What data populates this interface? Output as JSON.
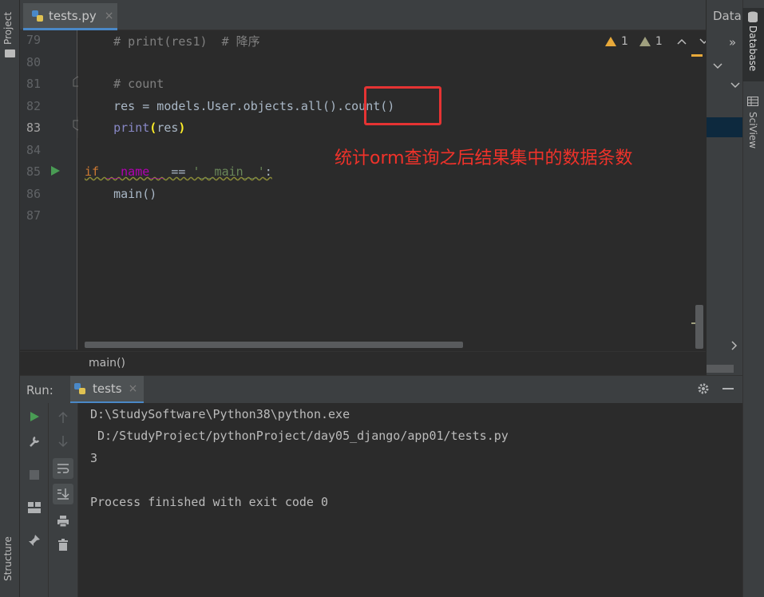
{
  "left_strip": {
    "project_label": "Project",
    "structure_label": "Structure"
  },
  "editor_tab": {
    "filename": "tests.py",
    "close": "×"
  },
  "inspections": {
    "warnings": "1",
    "weak_warnings": "1",
    "up": "^",
    "down": "v"
  },
  "lines": [
    {
      "num": "79",
      "code": "    # print(res1)  # 降序"
    },
    {
      "num": "80",
      "code": ""
    },
    {
      "num": "81",
      "code": "    # count"
    },
    {
      "num": "82",
      "code_plain_a": "    res = models.User.objects.all()",
      "code_plain_b": ".count()"
    },
    {
      "num": "83",
      "code_print": "print",
      "code_args": "res"
    },
    {
      "num": "84",
      "code": ""
    },
    {
      "num": "85",
      "kw_if": "if",
      "name": "__name__",
      "eq": " == ",
      "main_str": "'__main__'",
      "colon": ":"
    },
    {
      "num": "86",
      "code": "    main()"
    },
    {
      "num": "87",
      "code": ""
    }
  ],
  "annotation": "统计orm查询之后结果集中的数据条数",
  "breadcrumb": "main()",
  "right": {
    "datab": "Datab",
    "database": "Database",
    "sciview": "SciView",
    "arrows": "»"
  },
  "run": {
    "label": "Run:",
    "tab": "tests",
    "tab_close": "×",
    "output": [
      "D:\\StudySoftware\\Python38\\python.exe",
      " D:/StudyProject/pythonProject/day05_django/app01/tests.py",
      "3",
      "",
      "Process finished with exit code 0"
    ]
  },
  "icons": {
    "run": "run-icon",
    "wrench": "wrench-icon",
    "stop": "stop-icon",
    "layout": "layout-icon",
    "pin": "pin-icon",
    "up": "arrow-up-icon",
    "down": "arrow-down-icon",
    "wrap": "soft-wrap-icon",
    "scroll": "scroll-to-end-icon",
    "print": "print-icon",
    "trash": "trash-icon",
    "gear": "gear-icon",
    "minimize": "minimize-icon"
  }
}
